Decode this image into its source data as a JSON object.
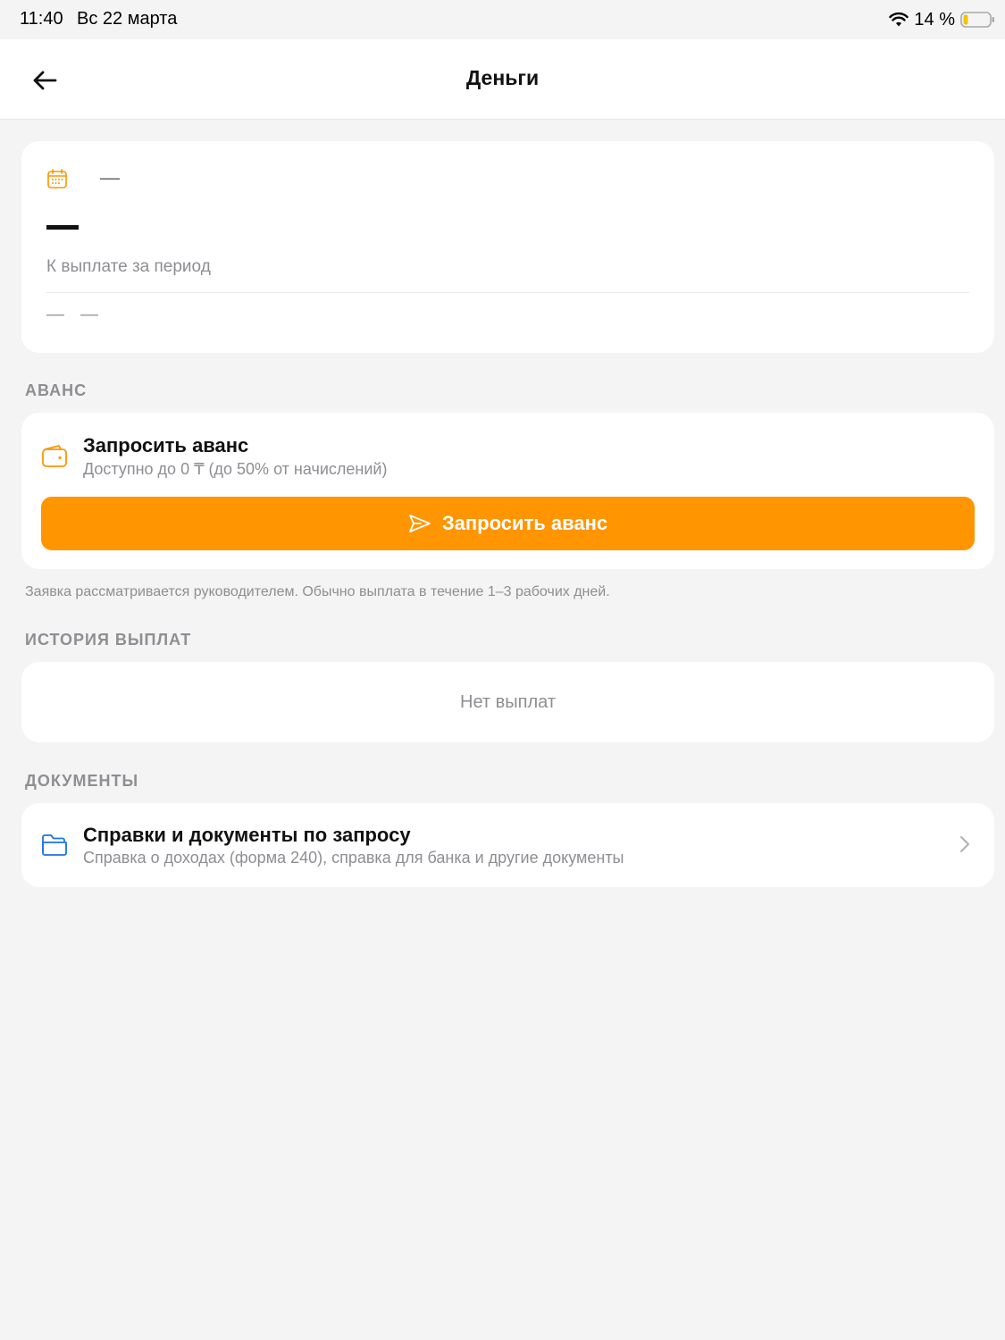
{
  "status_bar": {
    "time": "11:40",
    "date": "Вс 22 марта",
    "battery": "14 %",
    "icons": [
      "wifi-icon",
      "battery-icon"
    ]
  },
  "header": {
    "title": "Деньги",
    "back_icon": "arrow-left-icon"
  },
  "summary": {
    "period": "—",
    "label": "К выплате за период",
    "footer_left": "—",
    "footer_right": "—",
    "icon": "calendar-icon"
  },
  "advance": {
    "section_title": "АВАНС",
    "title": "Запросить аванс",
    "subtitle": "Доступно до 0 ₸ (до 50% от начислений)",
    "button_label": "Запросить аванс",
    "note": "Заявка рассматривается руководителем. Обычно выплата в течение 1–3 рабочих дней.",
    "icons": [
      "wallet-icon",
      "send-icon"
    ]
  },
  "history": {
    "section_title": "ИСТОРИЯ ВЫПЛАТ",
    "empty_text": "Нет выплат"
  },
  "documents": {
    "section_title": "ДОКУМЕНТЫ",
    "title": "Справки и документы по запросу",
    "subtitle": "Справка о доходах (форма 240), справка для банка и другие документы",
    "icons": [
      "folder-icon",
      "chevron-right-icon"
    ]
  },
  "colors": {
    "accent": "#ff9500",
    "folder_blue": "#1a73e8",
    "background": "#f4f4f5",
    "muted_text": "#8e8e93"
  }
}
